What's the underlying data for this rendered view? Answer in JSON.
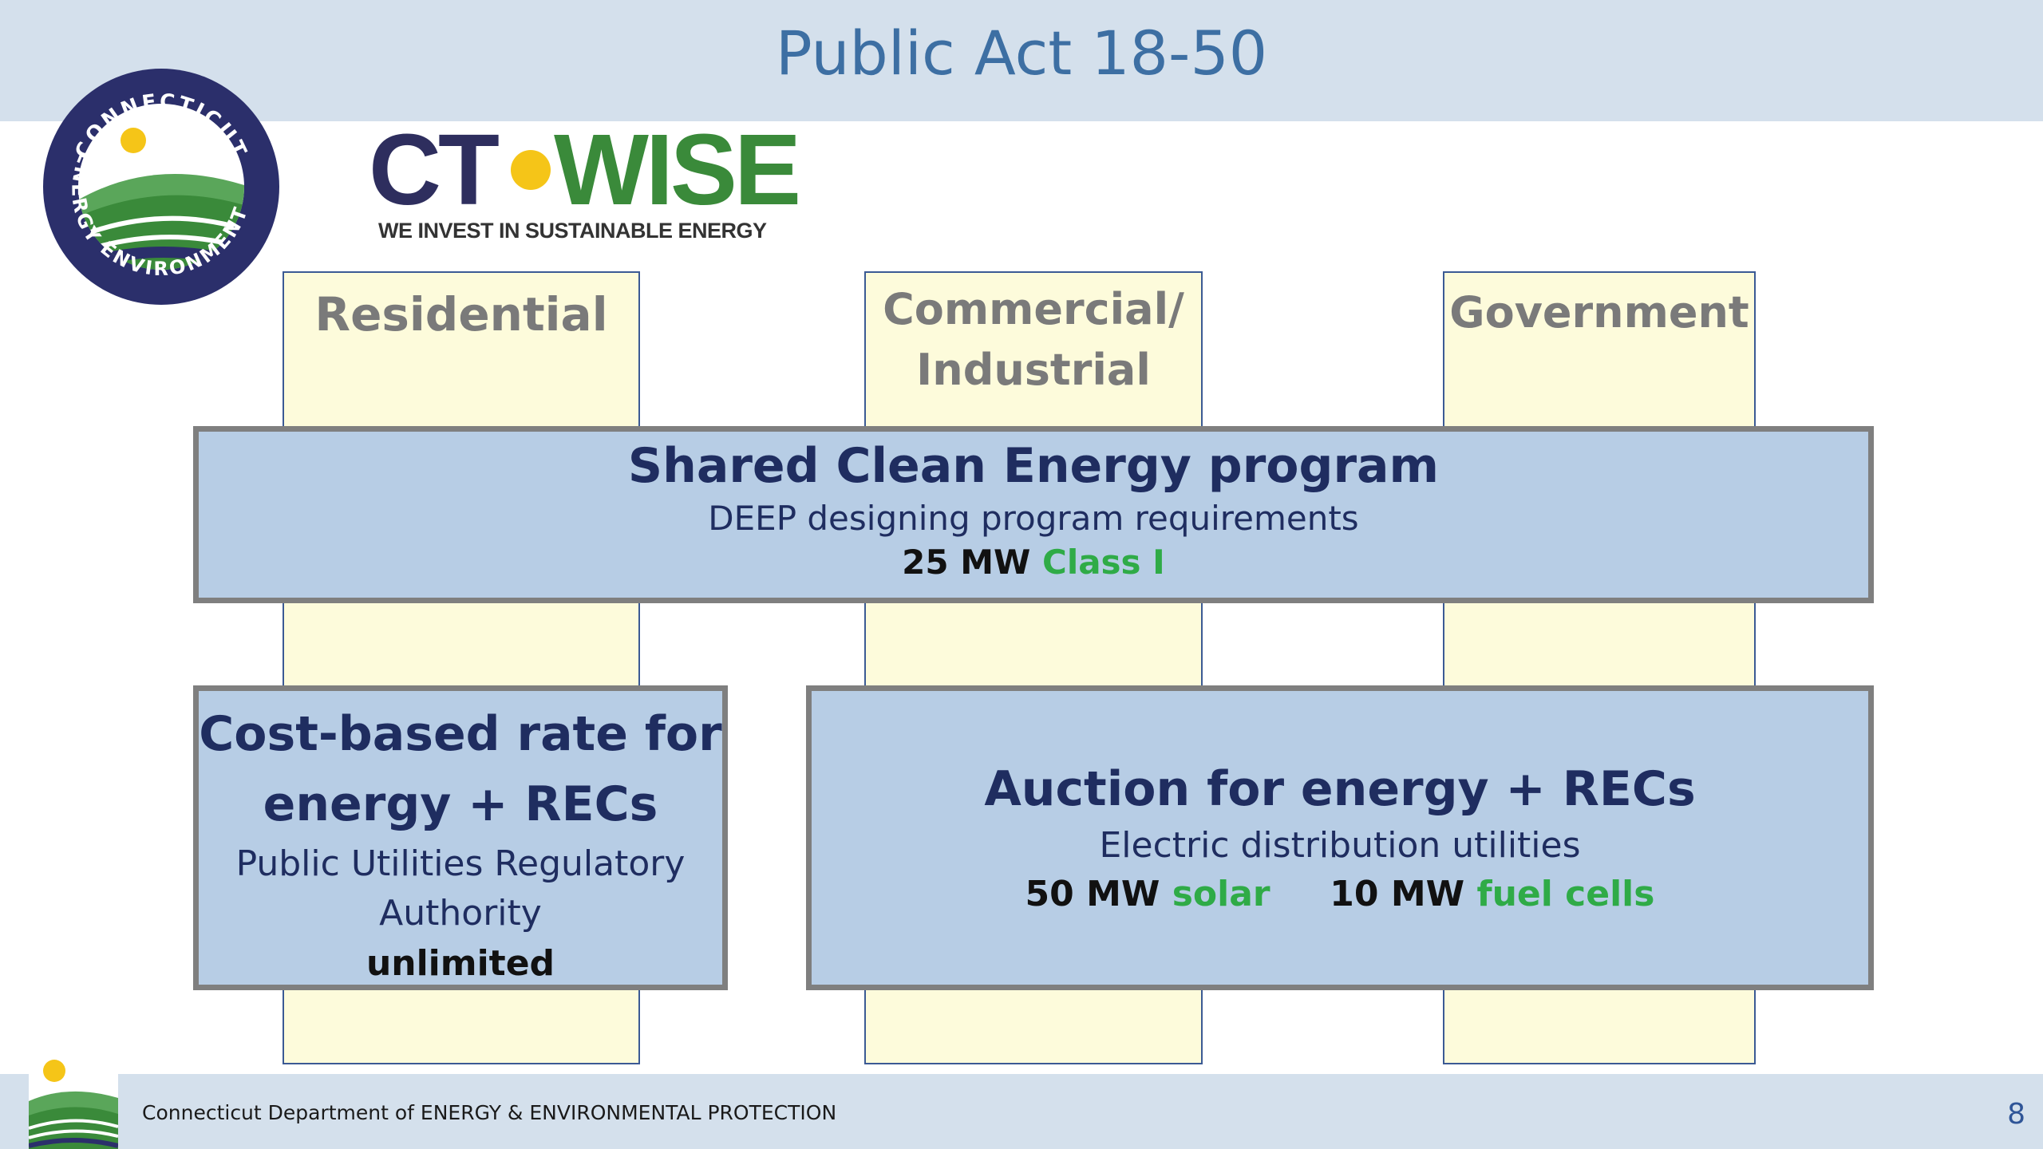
{
  "header": {
    "title": "Public Act 18-50"
  },
  "logos": {
    "seal_top": "CONNECTICUT",
    "seal_left": "ENERGY",
    "seal_bottom": "ENVIRONMENT",
    "ctwise_left": "CT",
    "ctwise_right": "WISE",
    "ctwise_tagline": "WE INVEST IN SUSTAINABLE ENERGY"
  },
  "columns": {
    "residential": "Residential",
    "commercial_line1": "Commercial/",
    "commercial_line2": "Industrial",
    "government": "Government"
  },
  "shared": {
    "heading": "Shared Clean Energy program",
    "subtitle": "DEEP designing program requirements",
    "capacity": "25 MW",
    "class": "Class I"
  },
  "cost": {
    "heading_line1": "Cost-based rate for",
    "heading_line2": "energy + RECs",
    "subtitle_line1": "Public Utilities Regulatory",
    "subtitle_line2": "Authority",
    "limit": "unlimited"
  },
  "auction": {
    "heading": "Auction for energy + RECs",
    "subtitle": "Electric distribution utilities",
    "solar_mw": "50 MW",
    "solar_label": "solar",
    "fuel_mw": "10 MW",
    "fuel_label": "fuel cells"
  },
  "footer": {
    "department": "Connecticut Department of ENERGY & ENVIRONMENTAL PROTECTION",
    "page_number": "8"
  },
  "colors": {
    "header_bg": "#d4e0ec",
    "title": "#3d6fa3",
    "column_fill": "#fdfbdb",
    "box_fill": "#b7cde5",
    "box_text": "#1f2d60",
    "green": "#2fab47",
    "ctwise_navy": "#2e2e5e",
    "ctwise_green": "#3a8a3a"
  }
}
